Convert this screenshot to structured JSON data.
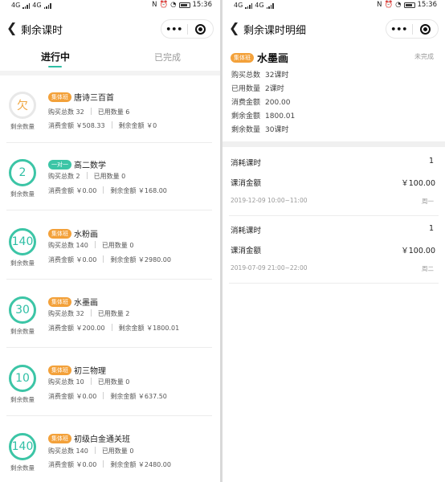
{
  "status_bar": {
    "time": "15:36",
    "carrier": "4G",
    "net": "4G"
  },
  "left": {
    "nav_title": "剩余课时",
    "capsule_more": "•••",
    "tabs": [
      {
        "label": "进行中"
      },
      {
        "label": "已完成"
      }
    ],
    "courses": [
      {
        "circle": "欠",
        "circle_label": "剩余数量",
        "badge": "集体班",
        "title": "唐诗三百首",
        "bought": "购买总数  32",
        "used": "已用数量  6",
        "spent": "消费金额 ￥508.33",
        "remaining": "剩余金额  ￥0"
      },
      {
        "circle": "2",
        "circle_label": "剩余数量",
        "badge": "一对一",
        "title": "高二数学",
        "bought": "购买总数  2",
        "used": "已用数量  0",
        "spent": "消费金额 ￥0.00",
        "remaining": "剩余金额 ￥168.00"
      },
      {
        "circle": "140",
        "circle_label": "剩余数量",
        "badge": "集体班",
        "title": "水粉画",
        "bought": "购买总数  140",
        "used": "已用数量  0",
        "spent": "消费金额 ￥0.00",
        "remaining": "剩余金额 ￥2980.00"
      },
      {
        "circle": "30",
        "circle_label": "剩余数量",
        "badge": "集体班",
        "title": "水墨画",
        "bought": "购买总数  32",
        "used": "已用数量  2",
        "spent": "消费金额 ￥200.00",
        "remaining": "剩余金额 ￥1800.01"
      },
      {
        "circle": "10",
        "circle_label": "剩余数量",
        "badge": "集体班",
        "title": "初三物理",
        "bought": "购买总数  10",
        "used": "已用数量  0",
        "spent": "消费金额 ￥0.00",
        "remaining": "剩余金额 ￥637.50"
      },
      {
        "circle": "140",
        "circle_label": "剩余数量",
        "badge": "集体班",
        "title": "初级白金通关班",
        "bought": "购买总数  140",
        "used": "已用数量  0",
        "spent": "消费金额 ￥0.00",
        "remaining": "剩余金额 ￥2480.00"
      }
    ]
  },
  "right": {
    "nav_title": "剩余课时明细",
    "capsule_more": "•••",
    "badge": "集体班",
    "title": "水墨画",
    "status": "未完成",
    "details": [
      {
        "label": "购买总数",
        "value": "32课时"
      },
      {
        "label": "已用数量",
        "value": "2课时"
      },
      {
        "label": "消费金额",
        "value": "200.00"
      },
      {
        "label": "剩余金额",
        "value": "1800.01"
      },
      {
        "label": "剩余数量",
        "value": "30课时"
      }
    ],
    "records": [
      {
        "consume_label": "消耗课时",
        "consume_value": "1",
        "amount_label": "课消金额",
        "amount_value": "￥100.00",
        "datetime": "2019-12-09    10:00~11:00",
        "weekday": "周一"
      },
      {
        "consume_label": "消耗课时",
        "consume_value": "1",
        "amount_label": "课消金额",
        "amount_value": "￥100.00",
        "datetime": "2019-07-09    21:00~22:00",
        "weekday": "周二"
      }
    ]
  },
  "colors": {
    "accent": "#2fbfa5",
    "badge_orange": "#f3a13a",
    "owe": "#f0a640"
  }
}
